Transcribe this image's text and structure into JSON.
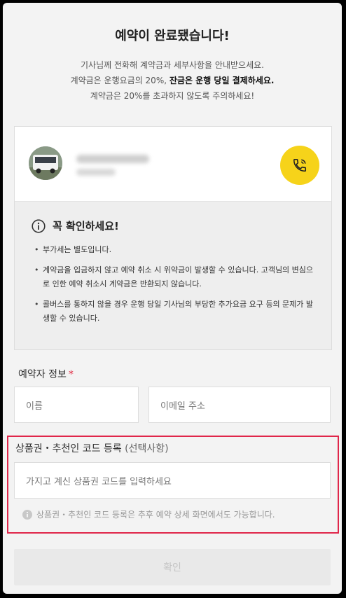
{
  "header": {
    "title": "예약이 완료됐습니다!",
    "line1": "기사님께 전화해 계약금과 세부사항을 안내받으세요.",
    "line2_prefix": "계약금은 운행요금의 20%, ",
    "line2_strong": "잔금은 운행 당일 결제하세요.",
    "line3": "계약금은 20%를 초과하지 않도록 주의하세요!"
  },
  "driver": {
    "avatar_icon": "bus-photo-avatar",
    "call_icon": "phone-icon",
    "call_color": "#f6d31a"
  },
  "notice": {
    "icon": "info-circle-icon",
    "title": "꼭 확인하세요!",
    "items": [
      "부가세는 별도입니다.",
      "계약금을 입금하지 않고 예약 취소 시 위약금이 발생할 수 있습니다. 고객님의 변심으로 인한 예약 취소시 계약금은 반환되지 않습니다.",
      "콜버스를 통하지 않을 경우 운행 당일 기사님의 부당한 추가요금 요구 등의 문제가 발생할 수 있습니다."
    ]
  },
  "booker": {
    "label": "예약자 정보",
    "required_mark": "*",
    "name_placeholder": "이름",
    "email_placeholder": "이메일 주소"
  },
  "coupon": {
    "label": "상품권・추천인 코드 등록",
    "optional": "(선택사항)",
    "placeholder": "가지고 계신 상품권 코드를 입력하세요",
    "hint": "상품권・추천인 코드 등록은 추후 예약 상세 화면에서도 가능합니다.",
    "highlight_color": "#e0264a"
  },
  "footer": {
    "confirm_label": "확인"
  }
}
